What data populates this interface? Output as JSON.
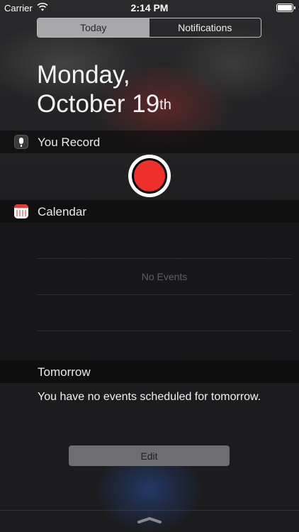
{
  "status_bar": {
    "carrier": "Carrier",
    "time": "2:14 PM"
  },
  "tabs": [
    {
      "label": "Today",
      "active": true
    },
    {
      "label": "Notifications",
      "active": false
    }
  ],
  "date": {
    "line1": "Monday,",
    "line2": "October 19",
    "suffix": "th"
  },
  "widgets": {
    "recorder": {
      "title": "You Record",
      "icon": "microphone-icon",
      "record_color": "#ef2f2b"
    },
    "calendar": {
      "title": "Calendar",
      "icon": "calendar-icon",
      "empty_text": "No Events",
      "tomorrow_header": "Tomorrow",
      "tomorrow_text": "You have no events scheduled for tomorrow."
    }
  },
  "edit_label": "Edit",
  "icons": {
    "wifi": "wifi-icon",
    "battery": "battery-icon",
    "handle": "chevron-up-handle-icon"
  }
}
